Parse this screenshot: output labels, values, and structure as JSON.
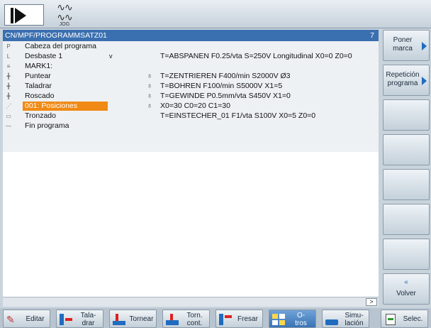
{
  "header": {
    "mode_label": "JOG",
    "program_path": "CN/MPF/PROGRAMMSATZ01",
    "program_count": "7"
  },
  "program_lines": [
    {
      "icon": "P",
      "name": "Cabeza del programa",
      "marker": "",
      "cycle_icon": "",
      "params": ""
    },
    {
      "icon": "L",
      "name": "Desbaste 1",
      "marker": "v",
      "cycle_icon": "",
      "params": "T=ABSPANEN F0.25/vta S=250V Longitudinal X0=0 Z0=0"
    },
    {
      "icon": "≡",
      "name": "MARK1:",
      "marker": "",
      "cycle_icon": "",
      "params": ""
    },
    {
      "icon": "╋",
      "name": "Puntear",
      "marker": "",
      "cycle_icon": "♁",
      "params": "T=ZENTRIEREN F400/min S2000V Ø3"
    },
    {
      "icon": "╋",
      "name": "Taladrar",
      "marker": "",
      "cycle_icon": "♁",
      "params": "T=BOHREN F100/min S5000V X1=5"
    },
    {
      "icon": "╋",
      "name": "Roscado",
      "marker": "",
      "cycle_icon": "♁",
      "params": "T=GEWINDE P0.5mm/vta S450V X1=0"
    },
    {
      "icon": "⋰",
      "name": "001: Posiciones",
      "marker": "",
      "cycle_icon": "♁",
      "params": "X0=30 C0=20 C1=30"
    },
    {
      "icon": "▭",
      "name": "Tronzado",
      "marker": "",
      "cycle_icon": "",
      "params": "T=EINSTECHER_01 F1/vta S100V X0=5 Z0=0"
    },
    {
      "icon": "—",
      "name": "Fin programa",
      "marker": "",
      "cycle_icon": "",
      "params": ""
    }
  ],
  "selected_line": 6,
  "scroll": {
    "right_label": ">"
  },
  "vertical_softkeys": [
    {
      "label_line1": "Poner",
      "label_line2": "marca"
    },
    {
      "label_line1": "Repetición",
      "label_line2": "programa"
    },
    {
      "label_line1": "",
      "label_line2": ""
    },
    {
      "label_line1": "",
      "label_line2": ""
    },
    {
      "label_line1": "",
      "label_line2": ""
    },
    {
      "label_line1": "",
      "label_line2": ""
    },
    {
      "label_line1": "",
      "label_line2": ""
    },
    {
      "label_line1": "«",
      "label_line2": "Volver"
    }
  ],
  "bottom_softkeys": [
    {
      "line1": "Editar",
      "line2": ""
    },
    {
      "line1": "Tala-",
      "line2": "drar"
    },
    {
      "line1": "Tornear",
      "line2": ""
    },
    {
      "line1": "Torn.",
      "line2": "cont."
    },
    {
      "line1": "Fresar",
      "line2": ""
    },
    {
      "line1": "O-",
      "line2": "tros"
    },
    {
      "line1": "Simu-",
      "line2": "lación"
    },
    {
      "line1": "Selec.",
      "line2": ""
    }
  ],
  "colors": {
    "accent": "#3a6fb0",
    "selection": "#f08a14",
    "softkey_icon_blue": "#1f6cc0",
    "softkey_icon_red": "#e02020"
  }
}
